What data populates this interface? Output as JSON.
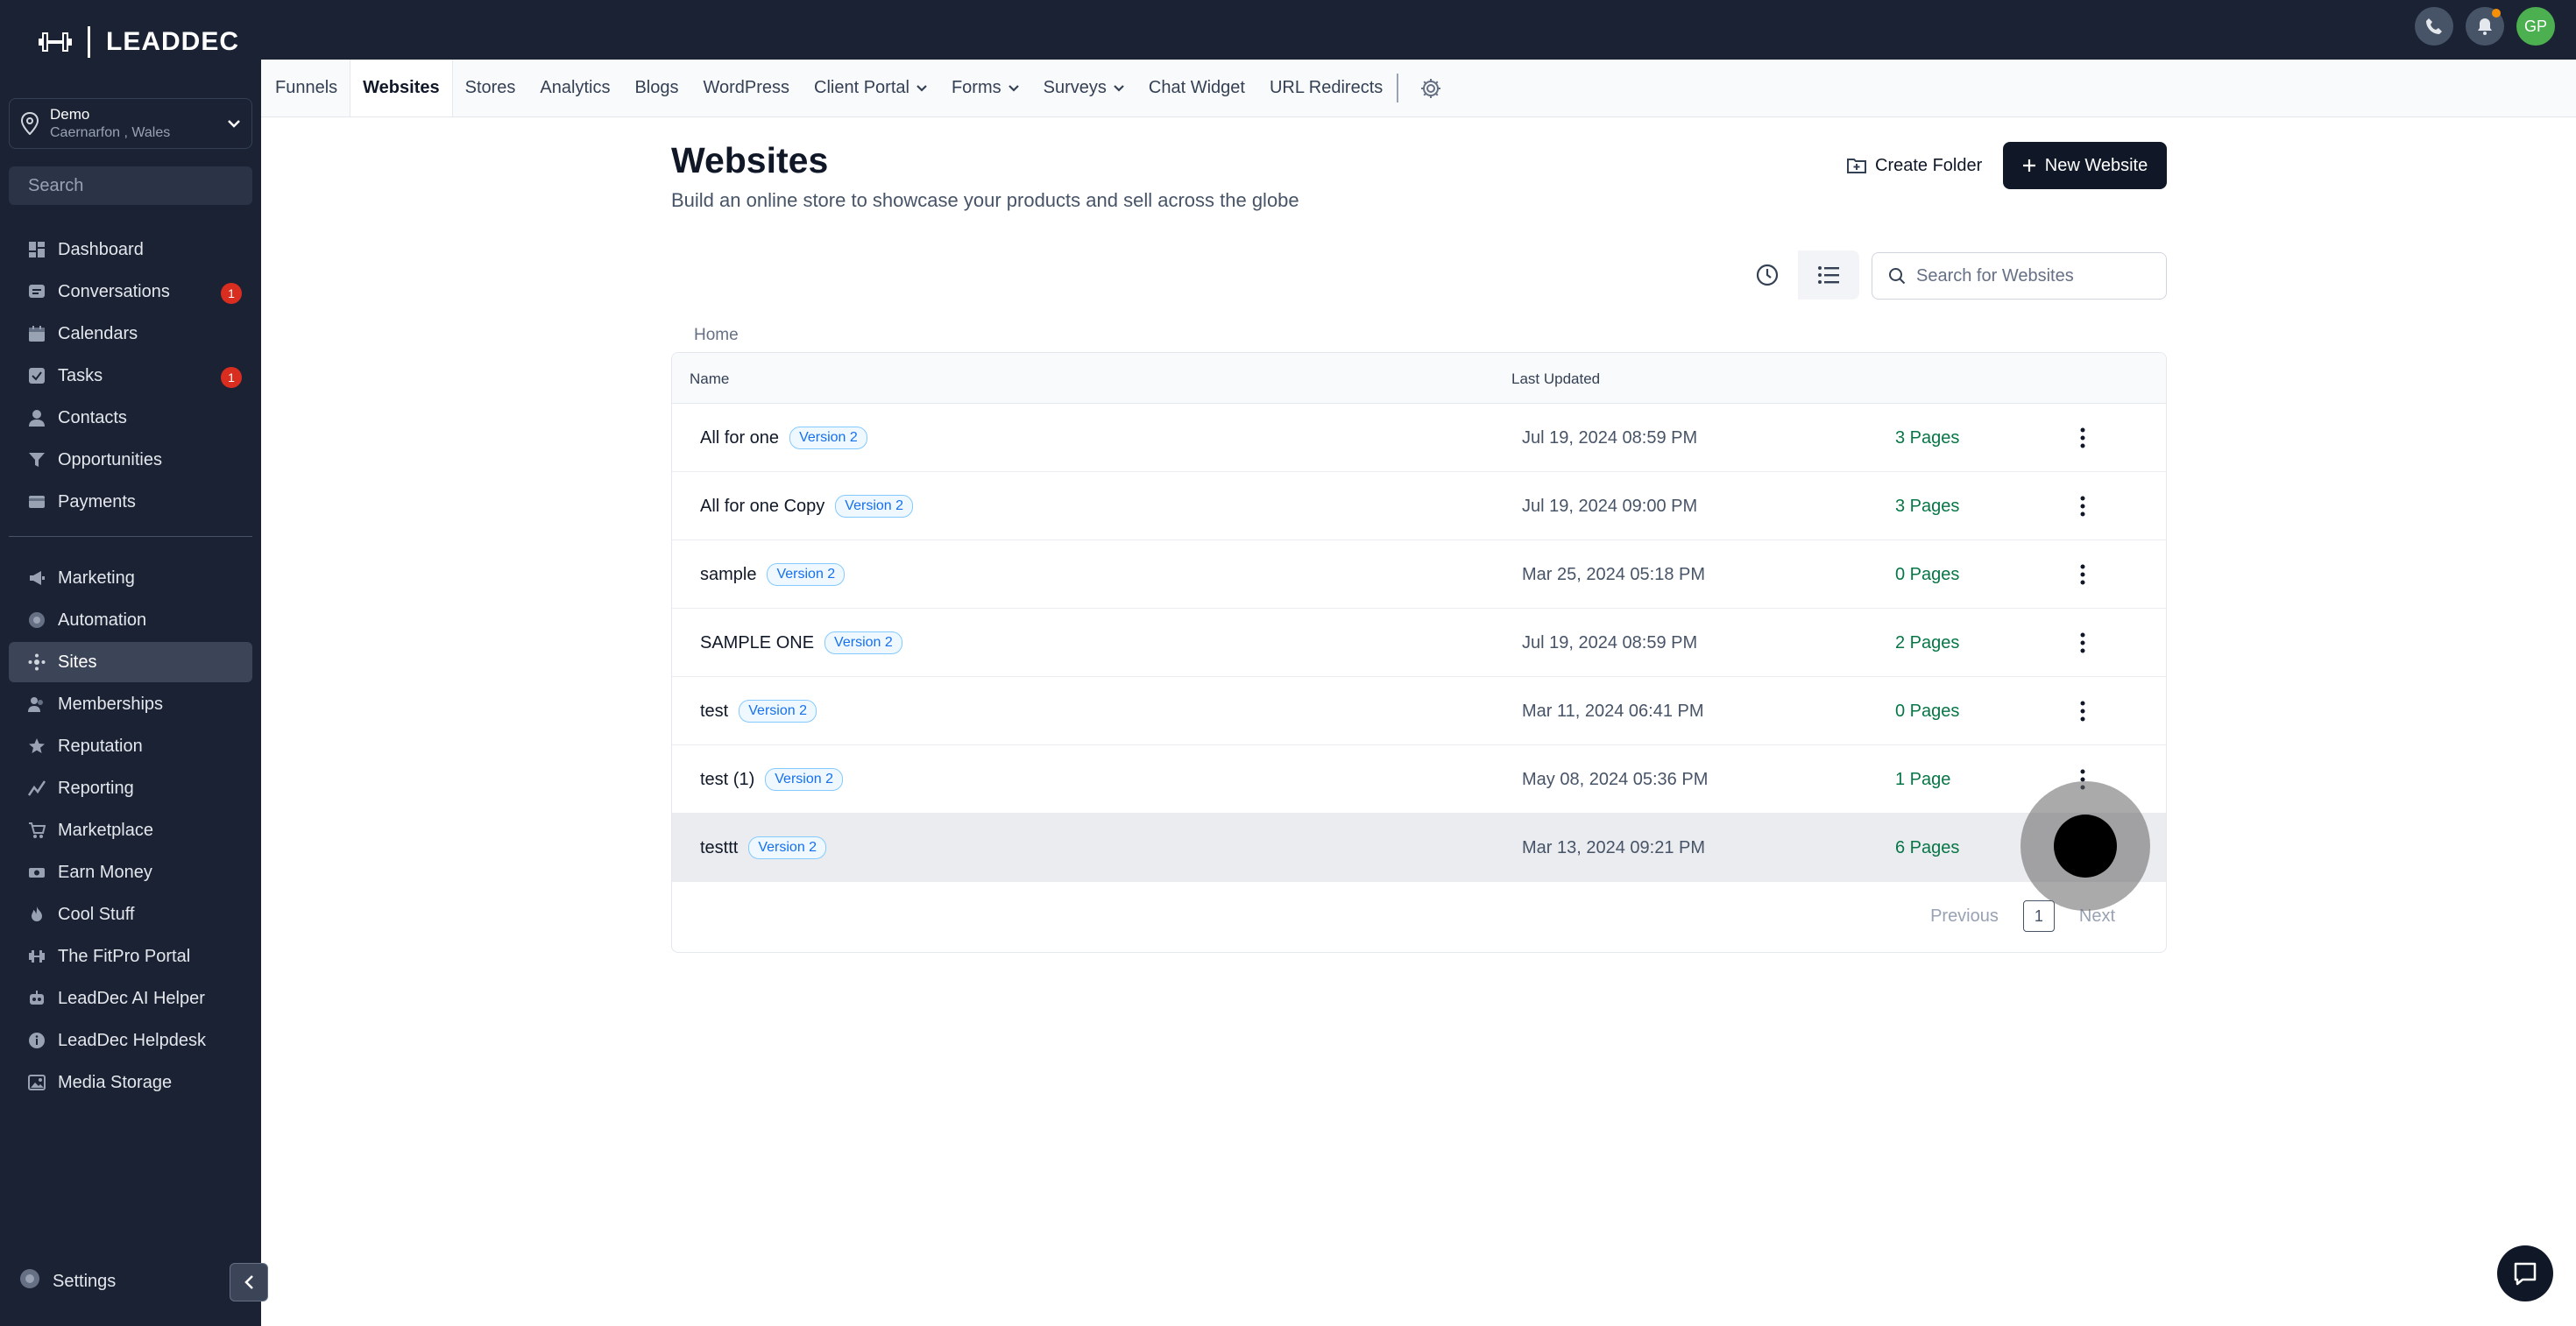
{
  "brand": {
    "name": "LEADDEC"
  },
  "account": {
    "name": "Demo",
    "location": "Caernarfon , Wales"
  },
  "sidebar": {
    "search_placeholder": "Search",
    "items_top": [
      {
        "label": "Dashboard",
        "icon": "dashboard-icon"
      },
      {
        "label": "Conversations",
        "icon": "chat-icon",
        "badge": "1"
      },
      {
        "label": "Calendars",
        "icon": "calendar-icon"
      },
      {
        "label": "Tasks",
        "icon": "check-icon",
        "badge": "1"
      },
      {
        "label": "Contacts",
        "icon": "person-icon"
      },
      {
        "label": "Opportunities",
        "icon": "funnel-icon"
      },
      {
        "label": "Payments",
        "icon": "card-icon"
      }
    ],
    "items_bottom": [
      {
        "label": "Marketing",
        "icon": "megaphone-icon"
      },
      {
        "label": "Automation",
        "icon": "automation-icon"
      },
      {
        "label": "Sites",
        "icon": "globe-icon",
        "active": true
      },
      {
        "label": "Memberships",
        "icon": "members-icon"
      },
      {
        "label": "Reputation",
        "icon": "star-icon"
      },
      {
        "label": "Reporting",
        "icon": "chart-icon"
      },
      {
        "label": "Marketplace",
        "icon": "cart-icon"
      },
      {
        "label": "Earn Money",
        "icon": "money-icon"
      },
      {
        "label": "Cool Stuff",
        "icon": "fire-icon"
      },
      {
        "label": "The FitPro Portal",
        "icon": "dumbbell-icon"
      },
      {
        "label": "LeadDec AI Helper",
        "icon": "robot-icon"
      },
      {
        "label": "LeadDec Helpdesk",
        "icon": "info-icon"
      },
      {
        "label": "Media Storage",
        "icon": "image-icon"
      }
    ],
    "settings_label": "Settings"
  },
  "topbar": {
    "avatar_initials": "GP"
  },
  "tabs": [
    {
      "label": "Funnels"
    },
    {
      "label": "Websites",
      "active": true
    },
    {
      "label": "Stores"
    },
    {
      "label": "Analytics"
    },
    {
      "label": "Blogs"
    },
    {
      "label": "WordPress"
    },
    {
      "label": "Client Portal",
      "dropdown": true
    },
    {
      "label": "Forms",
      "dropdown": true
    },
    {
      "label": "Surveys",
      "dropdown": true
    },
    {
      "label": "Chat Widget"
    },
    {
      "label": "URL Redirects"
    }
  ],
  "main": {
    "title": "Websites",
    "subtitle": "Build an online store to showcase your products and sell across the globe",
    "create_folder_label": "Create Folder",
    "new_website_label": "New Website",
    "search_placeholder": "Search for Websites",
    "breadcrumb": "Home"
  },
  "table": {
    "columns": {
      "name": "Name",
      "updated": "Last Updated"
    },
    "rows": [
      {
        "name": "All for one",
        "version": "Version 2",
        "updated": "Jul 19, 2024 08:59 PM",
        "pages": "3 Pages"
      },
      {
        "name": "All for one Copy",
        "version": "Version 2",
        "updated": "Jul 19, 2024 09:00 PM",
        "pages": "3 Pages"
      },
      {
        "name": "sample",
        "version": "Version 2",
        "updated": "Mar 25, 2024 05:18 PM",
        "pages": "0 Pages"
      },
      {
        "name": "SAMPLE ONE",
        "version": "Version 2",
        "updated": "Jul 19, 2024 08:59 PM",
        "pages": "2 Pages"
      },
      {
        "name": "test",
        "version": "Version 2",
        "updated": "Mar 11, 2024 06:41 PM",
        "pages": "0 Pages"
      },
      {
        "name": "test (1)",
        "version": "Version 2",
        "updated": "May 08, 2024 05:36 PM",
        "pages": "1 Page"
      },
      {
        "name": "testtt",
        "version": "Version 2",
        "updated": "Mar 13, 2024 09:21 PM",
        "pages": "6 Pages",
        "hover": true
      }
    ],
    "pagination": {
      "previous": "Previous",
      "page": "1",
      "next": "Next"
    }
  }
}
